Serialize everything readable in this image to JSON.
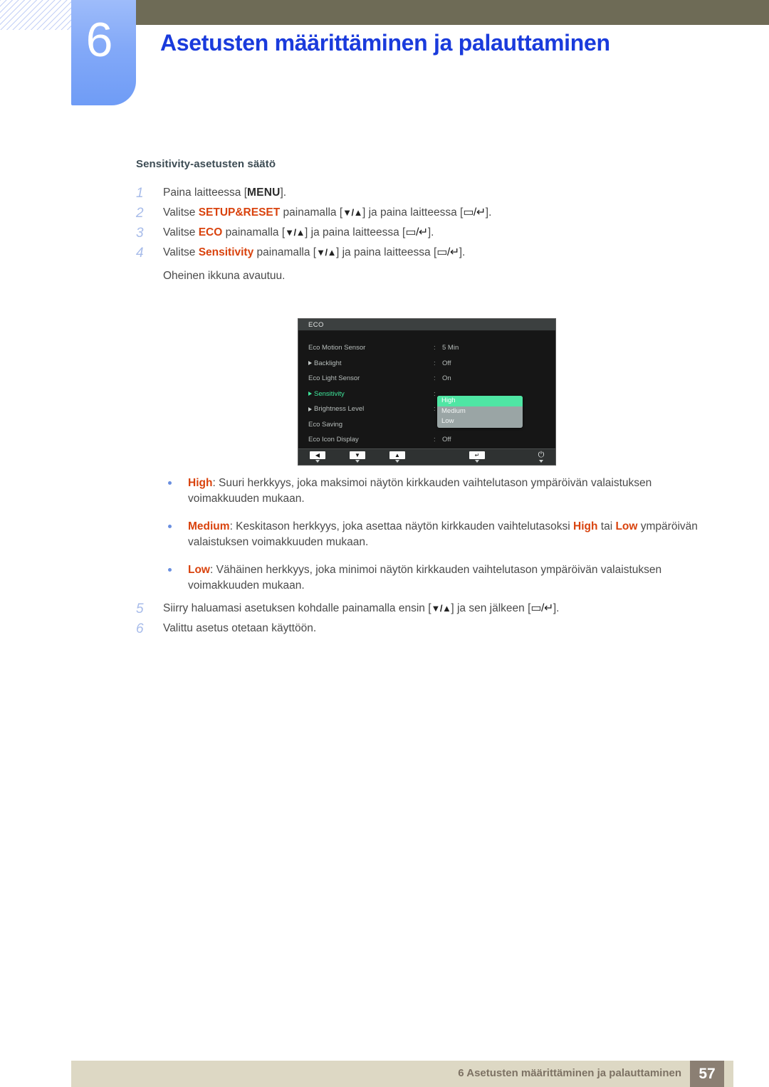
{
  "header": {
    "chapter_number": "6",
    "title": "Asetusten määrittäminen ja palauttaminen",
    "title_color": "#1a3bdc",
    "bar_color": "#6e6b56",
    "tab_color": "#83a9f8"
  },
  "section": {
    "heading": "Sensitivity-asetusten säätö"
  },
  "steps": [
    {
      "num": "1",
      "parts": [
        {
          "t": "Paina laitteessa [",
          "s": "plain"
        },
        {
          "t": "MENU",
          "s": "menu"
        },
        {
          "t": "].",
          "s": "plain"
        }
      ]
    },
    {
      "num": "2",
      "parts": [
        {
          "t": "Valitse ",
          "s": "plain"
        },
        {
          "t": "SETUP&RESET",
          "s": "kw"
        },
        {
          "t": " painamalla [",
          "s": "plain"
        },
        {
          "t": "▼/▲",
          "s": "arrows"
        },
        {
          "t": "] ja paina laitteessa [",
          "s": "plain"
        },
        {
          "t": "▭/↵",
          "s": "btnsym"
        },
        {
          "t": "].",
          "s": "plain"
        }
      ]
    },
    {
      "num": "3",
      "parts": [
        {
          "t": "Valitse ",
          "s": "plain"
        },
        {
          "t": "ECO",
          "s": "kw"
        },
        {
          "t": " painamalla [",
          "s": "plain"
        },
        {
          "t": "▼/▲",
          "s": "arrows"
        },
        {
          "t": "] ja paina laitteessa [",
          "s": "plain"
        },
        {
          "t": "▭/↵",
          "s": "btnsym"
        },
        {
          "t": "].",
          "s": "plain"
        }
      ]
    },
    {
      "num": "4",
      "parts": [
        {
          "t": "Valitse ",
          "s": "plain"
        },
        {
          "t": "Sensitivity",
          "s": "kw"
        },
        {
          "t": " painamalla [",
          "s": "plain"
        },
        {
          "t": "▼/▲",
          "s": "arrows"
        },
        {
          "t": "] ja paina laitteessa [",
          "s": "plain"
        },
        {
          "t": "▭/↵",
          "s": "btnsym"
        },
        {
          "t": "].",
          "s": "plain"
        }
      ]
    }
  ],
  "note": "Oheinen ikkuna avautuu.",
  "osd": {
    "title": "ECO",
    "rows": [
      {
        "label": "Eco Motion Sensor",
        "arrow": false,
        "selected": false,
        "colon": ":",
        "value": "5 Min"
      },
      {
        "label": "Backlight",
        "arrow": true,
        "selected": false,
        "colon": ":",
        "value": "Off"
      },
      {
        "label": "Eco Light Sensor",
        "arrow": false,
        "selected": false,
        "colon": ":",
        "value": "On"
      },
      {
        "label": "Sensitivity",
        "arrow": true,
        "selected": true,
        "colon": ":",
        "value": ""
      },
      {
        "label": "Brightness Level",
        "arrow": true,
        "selected": false,
        "colon": ":",
        "value": ""
      },
      {
        "label": "Eco Saving",
        "arrow": false,
        "selected": false,
        "colon": "",
        "value": ""
      },
      {
        "label": "Eco Icon Display",
        "arrow": false,
        "selected": false,
        "colon": ":",
        "value": "Off"
      }
    ],
    "dropdown": {
      "items": [
        {
          "label": "High",
          "active": true
        },
        {
          "label": "Medium",
          "active": false
        },
        {
          "label": "Low",
          "active": false
        }
      ],
      "highlight_color": "#4fe6a4",
      "background_color": "#9aa5a5"
    },
    "keys": [
      {
        "name": "left-key",
        "glyph": "◀"
      },
      {
        "name": "down-key",
        "glyph": "▼"
      },
      {
        "name": "up-key",
        "glyph": "▲"
      },
      {
        "name": "enter-key",
        "glyph": "↵"
      },
      {
        "name": "power-key",
        "glyph": "⏻"
      }
    ]
  },
  "bullets": [
    {
      "parts": [
        {
          "t": "High",
          "s": "kw"
        },
        {
          "t": ": Suuri herkkyys, joka maksimoi näytön kirkkauden vaihtelutason ympäröivän valaistuksen voimakkuuden mukaan.",
          "s": "plain"
        }
      ]
    },
    {
      "parts": [
        {
          "t": "Medium",
          "s": "kw"
        },
        {
          "t": ": Keskitason herkkyys, joka asettaa näytön kirkkauden vaihtelutasoksi ",
          "s": "plain"
        },
        {
          "t": "High",
          "s": "kw"
        },
        {
          "t": " tai ",
          "s": "plain"
        },
        {
          "t": "Low",
          "s": "kw"
        },
        {
          "t": " ympäröivän valaistuksen voimakkuuden mukaan.",
          "s": "plain"
        }
      ]
    },
    {
      "parts": [
        {
          "t": "Low",
          "s": "kw"
        },
        {
          "t": ": Vähäinen herkkyys, joka minimoi näytön kirkkauden vaihtelutason ympäröivän valaistuksen voimakkuuden mukaan.",
          "s": "plain"
        }
      ]
    }
  ],
  "steps2": [
    {
      "num": "5",
      "parts": [
        {
          "t": "Siirry haluamasi asetuksen kohdalle painamalla ensin [",
          "s": "plain"
        },
        {
          "t": "▼/▲",
          "s": "arrows"
        },
        {
          "t": "] ja sen jälkeen [",
          "s": "plain"
        },
        {
          "t": "▭/↵",
          "s": "btnsym"
        },
        {
          "t": "].",
          "s": "plain"
        }
      ]
    },
    {
      "num": "6",
      "parts": [
        {
          "t": "Valittu asetus otetaan käyttöön.",
          "s": "plain"
        }
      ]
    }
  ],
  "footer": {
    "text": "6 Asetusten määrittäminen ja palauttaminen",
    "page": "57",
    "bar_color": "#ddd8c4",
    "page_box_color": "#8b7f73"
  }
}
